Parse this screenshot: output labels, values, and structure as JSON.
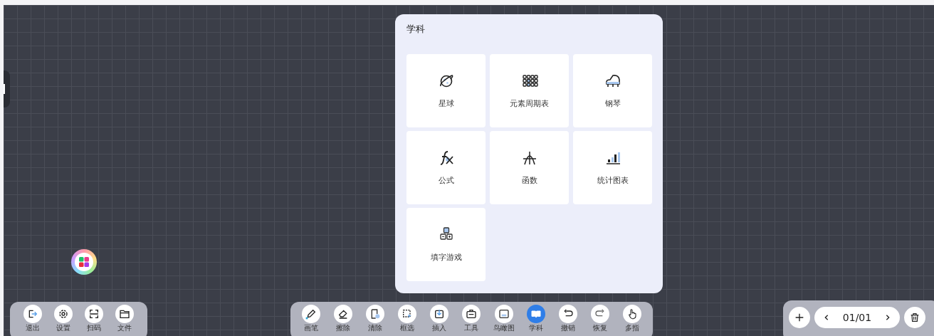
{
  "subject_panel": {
    "title": "学科",
    "items": [
      {
        "label": "星球"
      },
      {
        "label": "元素周期表"
      },
      {
        "label": "钢琴"
      },
      {
        "label": "公式"
      },
      {
        "label": "函数"
      },
      {
        "label": "统计图表"
      },
      {
        "label": "填字游戏"
      }
    ]
  },
  "left_toolbar": [
    {
      "label": "退出"
    },
    {
      "label": "设置"
    },
    {
      "label": "扫码"
    },
    {
      "label": "文件"
    }
  ],
  "main_toolbar": [
    {
      "label": "画笔",
      "selected": false
    },
    {
      "label": "擦除",
      "selected": false
    },
    {
      "label": "清除",
      "selected": false
    },
    {
      "label": "框选",
      "selected": false
    },
    {
      "label": "插入",
      "selected": false
    },
    {
      "label": "工具",
      "selected": false
    },
    {
      "label": "鸟瞰图",
      "selected": false
    },
    {
      "label": "学科",
      "selected": true
    },
    {
      "label": "撤销",
      "selected": false
    },
    {
      "label": "恢复",
      "selected": false
    },
    {
      "label": "多指",
      "selected": false
    }
  ],
  "pager": {
    "page": "01/01"
  }
}
